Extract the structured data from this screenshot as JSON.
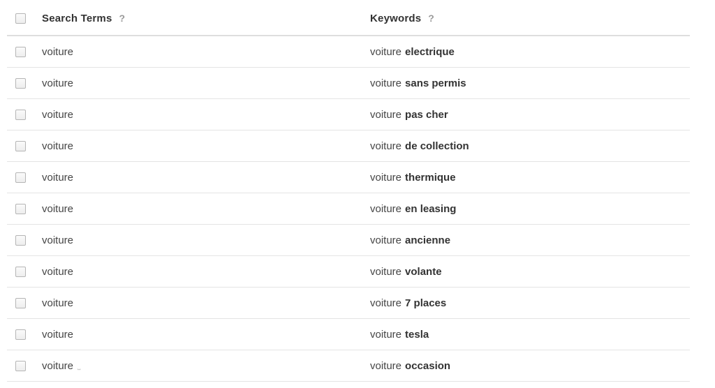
{
  "table": {
    "columns": [
      {
        "id": "search_terms",
        "label": "Search Terms",
        "help_icon": "?"
      },
      {
        "id": "keywords",
        "label": "Keywords",
        "help_icon": "?"
      }
    ],
    "select_all_checkbox": "unchecked",
    "rows": [
      {
        "checkbox": "unchecked",
        "search_term": "voiture",
        "keyword_base": "voiture",
        "keyword_highlight": "electrique"
      },
      {
        "checkbox": "unchecked",
        "search_term": "voiture",
        "keyword_base": "voiture",
        "keyword_highlight": "sans permis"
      },
      {
        "checkbox": "unchecked",
        "search_term": "voiture",
        "keyword_base": "voiture",
        "keyword_highlight": "pas cher"
      },
      {
        "checkbox": "unchecked",
        "search_term": "voiture",
        "keyword_base": "voiture",
        "keyword_highlight": "de collection"
      },
      {
        "checkbox": "unchecked",
        "search_term": "voiture",
        "keyword_base": "voiture",
        "keyword_highlight": "thermique"
      },
      {
        "checkbox": "unchecked",
        "search_term": "voiture",
        "keyword_base": "voiture",
        "keyword_highlight": "en leasing"
      },
      {
        "checkbox": "unchecked",
        "search_term": "voiture",
        "keyword_base": "voiture",
        "keyword_highlight": "ancienne"
      },
      {
        "checkbox": "unchecked",
        "search_term": "voiture",
        "keyword_base": "voiture",
        "keyword_highlight": "volante"
      },
      {
        "checkbox": "unchecked",
        "search_term": "voiture",
        "keyword_base": "voiture",
        "keyword_highlight": "7 places"
      },
      {
        "checkbox": "unchecked",
        "search_term": "voiture",
        "keyword_base": "voiture",
        "keyword_highlight": "tesla"
      },
      {
        "checkbox": "unchecked",
        "search_term": "voiture",
        "search_term_artifact": "˽",
        "keyword_base": "voiture",
        "keyword_highlight": "occasion"
      }
    ]
  },
  "colors": {
    "text_primary": "#333333",
    "text_body": "#454545",
    "separator": "#e4e4e4",
    "header_separator": "#dedede",
    "help_icon": "#9a9a9a",
    "checkbox_border": "#b5b5b5"
  }
}
